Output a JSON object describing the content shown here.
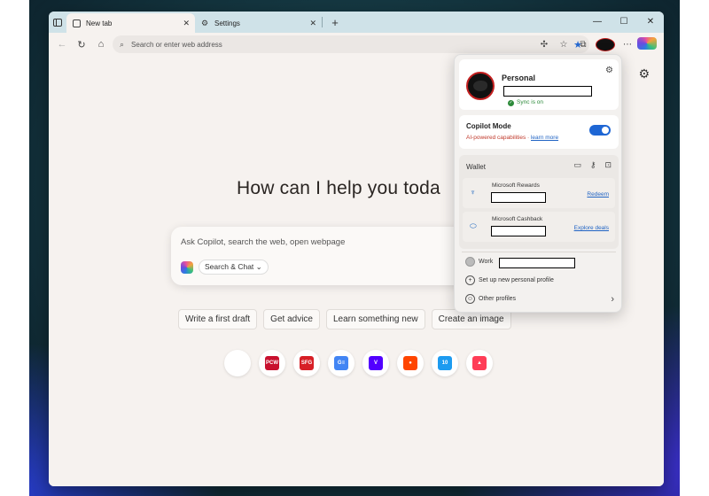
{
  "tabs": [
    {
      "label": "New tab",
      "icon": "page-icon",
      "active": true
    },
    {
      "label": "Settings",
      "icon": "gear-icon",
      "active": false
    }
  ],
  "addressbar": {
    "placeholder": "Search or enter web address"
  },
  "page": {
    "headline": "How can I help you toda",
    "ask_placeholder": "Ask Copilot, search the web, open webpage",
    "mode_label": "Search & Chat",
    "chips": [
      "Write a first draft",
      "Get advice",
      "Learn something new",
      "Create an image"
    ],
    "sites": [
      {
        "name": "blank",
        "label": "",
        "color": "#ffffff"
      },
      {
        "name": "pcworld",
        "label": "PCW",
        "color": "#c8102e"
      },
      {
        "name": "sfgate",
        "label": "SFG",
        "color": "#d71f26"
      },
      {
        "name": "google-news",
        "label": "G≡",
        "color": "#4285f4"
      },
      {
        "name": "verge",
        "label": "V",
        "color": "#5200ff"
      },
      {
        "name": "reddit",
        "label": "●",
        "color": "#ff4500"
      },
      {
        "name": "site-10",
        "label": "10",
        "color": "#1d9bf0"
      },
      {
        "name": "monday",
        "label": "▲",
        "color": "#ff3d57"
      }
    ]
  },
  "flyout": {
    "profile_name": "Personal",
    "sync_status": "Sync is on",
    "copilot_title": "Copilot Mode",
    "copilot_sub": "AI-powered capabilities · ",
    "copilot_link": "learn more",
    "wallet_title": "Wallet",
    "rewards_label": "Microsoft Rewards",
    "rewards_action": "Redeem",
    "cashback_label": "Microsoft Cashback",
    "cashback_action": "Explore deals",
    "work_label": "Work",
    "setup_label": "Set up new personal profile",
    "other_label": "Other profiles"
  },
  "colors": {
    "accent": "#1e66d4",
    "tabbar": "#cfe2e8",
    "page_bg": "#f6f2ef",
    "avatar_ring": "#c31f1f"
  }
}
